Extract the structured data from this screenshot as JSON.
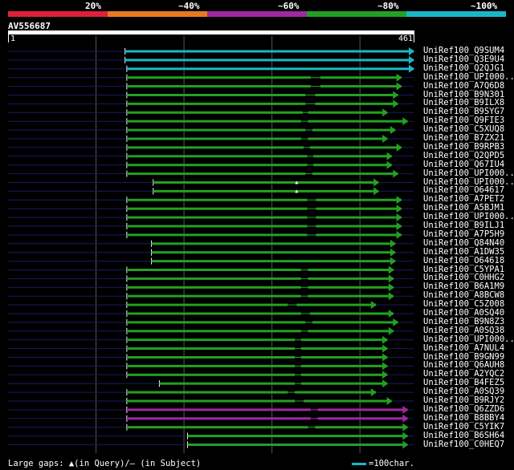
{
  "legend": {
    "segments": [
      {
        "label": "20%",
        "color": "#e0203a"
      },
      {
        "label": "~40%",
        "color": "#e87920"
      },
      {
        "label": "~60%",
        "color": "#9c2aa0"
      },
      {
        "label": "~80%",
        "color": "#23a023"
      },
      {
        "label": "~100%",
        "color": "#19b8c9"
      }
    ]
  },
  "query": {
    "id": "AV556687",
    "start_label": "1",
    "end_label": "461",
    "length": 461
  },
  "footer": {
    "gaps_text": "Large gaps: ▲(in Query)/– (in Subject)",
    "scale_text": "=100char."
  },
  "colors": {
    "background": "#000000",
    "gridline": "#555555",
    "unaligned": "#1a1a66"
  },
  "hits": [
    {
      "label": "UniRef100_Q9SUM4",
      "color": "#19b8c9",
      "start": 133,
      "end": 461,
      "gaps": []
    },
    {
      "label": "UniRef100_Q3E9U4",
      "color": "#19b8c9",
      "start": 133,
      "end": 461,
      "gaps": []
    },
    {
      "label": "UniRef100_Q2QJG1",
      "color": "#19b8c9",
      "start": 135,
      "end": 461,
      "gaps": []
    },
    {
      "label": "UniRef100_UPI000...",
      "color": "#23a023",
      "start": 135,
      "end": 447,
      "gaps": [
        [
          344,
          355
        ]
      ]
    },
    {
      "label": "UniRef100_A7Q6D8",
      "color": "#23a023",
      "start": 135,
      "end": 447,
      "gaps": [
        [
          344,
          355
        ]
      ]
    },
    {
      "label": "UniRef100_B9N301",
      "color": "#23a023",
      "start": 135,
      "end": 443,
      "gaps": [
        [
          338,
          349
        ]
      ]
    },
    {
      "label": "UniRef100_B9ILX8",
      "color": "#23a023",
      "start": 135,
      "end": 443,
      "gaps": [
        [
          338,
          349
        ]
      ]
    },
    {
      "label": "UniRef100_B9SYG7",
      "color": "#23a023",
      "start": 135,
      "end": 431,
      "gaps": [
        [
          335,
          341
        ]
      ]
    },
    {
      "label": "UniRef100_Q9FIE3",
      "color": "#23a023",
      "start": 135,
      "end": 454,
      "gaps": [
        [
          333,
          341
        ]
      ]
    },
    {
      "label": "UniRef100_C5XUQ8",
      "color": "#23a023",
      "start": 135,
      "end": 440,
      "gaps": [
        [
          338,
          346
        ]
      ]
    },
    {
      "label": "UniRef100_B7ZX21",
      "color": "#23a023",
      "start": 135,
      "end": 431,
      "gaps": [
        [
          333,
          341
        ]
      ]
    },
    {
      "label": "UniRef100_B9RPB3",
      "color": "#23a023",
      "start": 135,
      "end": 447,
      "gaps": [
        [
          336,
          343
        ]
      ]
    },
    {
      "label": "UniRef100_Q2QPD5",
      "color": "#23a023",
      "start": 135,
      "end": 436,
      "gaps": [
        [
          340,
          347
        ]
      ]
    },
    {
      "label": "UniRef100_Q67IU4",
      "color": "#23a023",
      "start": 135,
      "end": 436,
      "gaps": [
        [
          340,
          347
        ]
      ]
    },
    {
      "label": "UniRef100_UPI000...",
      "color": "#23a023",
      "start": 135,
      "end": 443,
      "gaps": [
        [
          338,
          346
        ]
      ]
    },
    {
      "label": "UniRef100_UPI000...",
      "color": "#23a023",
      "start": 165,
      "end": 421,
      "gaps": [],
      "insert": 328
    },
    {
      "label": "UniRef100_O64617",
      "color": "#23a023",
      "start": 165,
      "end": 421,
      "gaps": [],
      "insert": 328
    },
    {
      "label": "UniRef100_A7PET2",
      "color": "#23a023",
      "start": 135,
      "end": 447,
      "gaps": [
        [
          340,
          350
        ]
      ]
    },
    {
      "label": "UniRef100_A5BJM1",
      "color": "#23a023",
      "start": 135,
      "end": 447,
      "gaps": [
        [
          340,
          350
        ]
      ]
    },
    {
      "label": "UniRef100_UPI000...",
      "color": "#23a023",
      "start": 135,
      "end": 447,
      "gaps": [
        [
          340,
          350
        ]
      ]
    },
    {
      "label": "UniRef100_B9ILJ1",
      "color": "#23a023",
      "start": 135,
      "end": 447,
      "gaps": [
        [
          340,
          350
        ]
      ]
    },
    {
      "label": "UniRef100_A7P5H9",
      "color": "#23a023",
      "start": 135,
      "end": 447,
      "gaps": [
        [
          340,
          350
        ]
      ]
    },
    {
      "label": "UniRef100_Q84N40",
      "color": "#23a023",
      "start": 163,
      "end": 440,
      "gaps": []
    },
    {
      "label": "UniRef100_A1DW35",
      "color": "#23a023",
      "start": 163,
      "end": 440,
      "gaps": []
    },
    {
      "label": "UniRef100_O64618",
      "color": "#23a023",
      "start": 163,
      "end": 440,
      "gaps": []
    },
    {
      "label": "UniRef100_C5YPA1",
      "color": "#23a023",
      "start": 135,
      "end": 438,
      "gaps": [
        [
          333,
          341
        ]
      ]
    },
    {
      "label": "UniRef100_C0HHG2",
      "color": "#23a023",
      "start": 135,
      "end": 438,
      "gaps": [
        [
          333,
          341
        ]
      ]
    },
    {
      "label": "UniRef100_B6A1M9",
      "color": "#23a023",
      "start": 135,
      "end": 438,
      "gaps": [
        [
          333,
          341
        ]
      ]
    },
    {
      "label": "UniRef100_A8BCW8",
      "color": "#23a023",
      "start": 135,
      "end": 438,
      "gaps": [
        [
          333,
          341
        ]
      ]
    },
    {
      "label": "UniRef100_C5Z008",
      "color": "#23a023",
      "start": 135,
      "end": 418,
      "gaps": [
        [
          318,
          328
        ]
      ]
    },
    {
      "label": "UniRef100_A0SQ40",
      "color": "#23a023",
      "start": 135,
      "end": 438,
      "gaps": [
        [
          333,
          343
        ]
      ]
    },
    {
      "label": "UniRef100_B9N8Z3",
      "color": "#23a023",
      "start": 135,
      "end": 443,
      "gaps": [
        [
          338,
          346
        ]
      ]
    },
    {
      "label": "UniRef100_A0SQ38",
      "color": "#23a023",
      "start": 135,
      "end": 438,
      "gaps": [
        [
          333,
          341
        ]
      ]
    },
    {
      "label": "UniRef100_UPI000...",
      "color": "#23a023",
      "start": 135,
      "end": 431,
      "gaps": [
        [
          326,
          333
        ]
      ]
    },
    {
      "label": "UniRef100_A7NUL4",
      "color": "#23a023",
      "start": 135,
      "end": 431,
      "gaps": [
        [
          326,
          333
        ]
      ]
    },
    {
      "label": "UniRef100_B9GN99",
      "color": "#23a023",
      "start": 135,
      "end": 431,
      "gaps": [
        [
          326,
          333
        ]
      ]
    },
    {
      "label": "UniRef100_Q6AUH8",
      "color": "#23a023",
      "start": 135,
      "end": 431,
      "gaps": [
        [
          326,
          333
        ]
      ]
    },
    {
      "label": "UniRef100_A2YQC2",
      "color": "#23a023",
      "start": 135,
      "end": 431,
      "gaps": [
        [
          326,
          333
        ]
      ]
    },
    {
      "label": "UniRef100_B4FEZ5",
      "color": "#23a023",
      "start": 172,
      "end": 431,
      "gaps": [
        [
          326,
          333
        ]
      ]
    },
    {
      "label": "UniRef100_A0SQ39",
      "color": "#23a023",
      "start": 135,
      "end": 418,
      "gaps": [
        [
          318,
          326
        ]
      ]
    },
    {
      "label": "UniRef100_B9RJY2",
      "color": "#23a023",
      "start": 135,
      "end": 436,
      "gaps": [
        [
          326,
          336
        ]
      ]
    },
    {
      "label": "UniRef100_Q6ZZD6",
      "color": "#9c2aa0",
      "start": 135,
      "end": 454,
      "gaps": [
        [
          344,
          352
        ]
      ]
    },
    {
      "label": "UniRef100_B8BBY4",
      "color": "#9c2aa0",
      "start": 135,
      "end": 454,
      "gaps": [
        [
          344,
          352
        ]
      ]
    },
    {
      "label": "UniRef100_C5YIK7",
      "color": "#23a023",
      "start": 135,
      "end": 454,
      "gaps": [
        [
          341,
          349
        ]
      ]
    },
    {
      "label": "UniRef100_B6SH64",
      "color": "#23a023",
      "start": 204,
      "end": 454,
      "gaps": []
    },
    {
      "label": "UniRef100_C0HEQ7",
      "color": "#23a023",
      "start": 204,
      "end": 454,
      "gaps": []
    }
  ]
}
